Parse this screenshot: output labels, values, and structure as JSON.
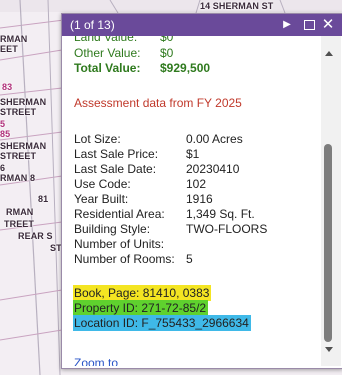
{
  "map": {
    "street_top_right": "14 SHERMAN ST",
    "labels": [
      {
        "text": "RMAN\nEET",
        "style": "dark"
      },
      {
        "text": "83",
        "style": "pink"
      },
      {
        "text": "SHERMAN\nSTREET",
        "style": "dark"
      },
      {
        "text": "5\n85",
        "style": "pink"
      },
      {
        "text": "SHERMAN\nSTREET",
        "style": "dark"
      },
      {
        "text": "6\nRMAN 8",
        "style": "dark"
      },
      {
        "text": "81",
        "style": "dark"
      },
      {
        "text": "RMAN",
        "style": "dark"
      },
      {
        "text": "TREET",
        "style": "dark"
      },
      {
        "text": "REAR S",
        "style": "dark"
      },
      {
        "text": "ST",
        "style": "dark"
      }
    ]
  },
  "popup": {
    "count": "(1 of 13)",
    "next_icon": "▶",
    "close_icon": "✕",
    "fields_top": [
      {
        "label": "Land Value:",
        "value": "$0"
      },
      {
        "label": "Other Value:",
        "value": "$0"
      },
      {
        "label": "Total Value:",
        "value": "$929,500"
      }
    ],
    "assessment_note": "Assessment data from FY 2025",
    "details": [
      {
        "label": "Lot Size:",
        "value": "0.00 Acres"
      },
      {
        "label": "Last Sale Price:",
        "value": "$1"
      },
      {
        "label": "Last Sale Date:",
        "value": "20230410"
      },
      {
        "label": "Use Code:",
        "value": "102"
      },
      {
        "label": "Year Built:",
        "value": "1916"
      },
      {
        "label": "Residential Area:",
        "value": "1,349 Sq. Ft."
      },
      {
        "label": "Building Style:",
        "value": "TWO-FLOORS"
      },
      {
        "label": "Number of Units:",
        "value": ""
      },
      {
        "label": "Number of Rooms:",
        "value": "5"
      }
    ],
    "book_page": "Book, Page:  81410, 0383",
    "property_id": "Property ID:  271-72-85/2",
    "location_id": "Location ID:  F_755433_2966634",
    "zoom_to": "Zoom to"
  }
}
